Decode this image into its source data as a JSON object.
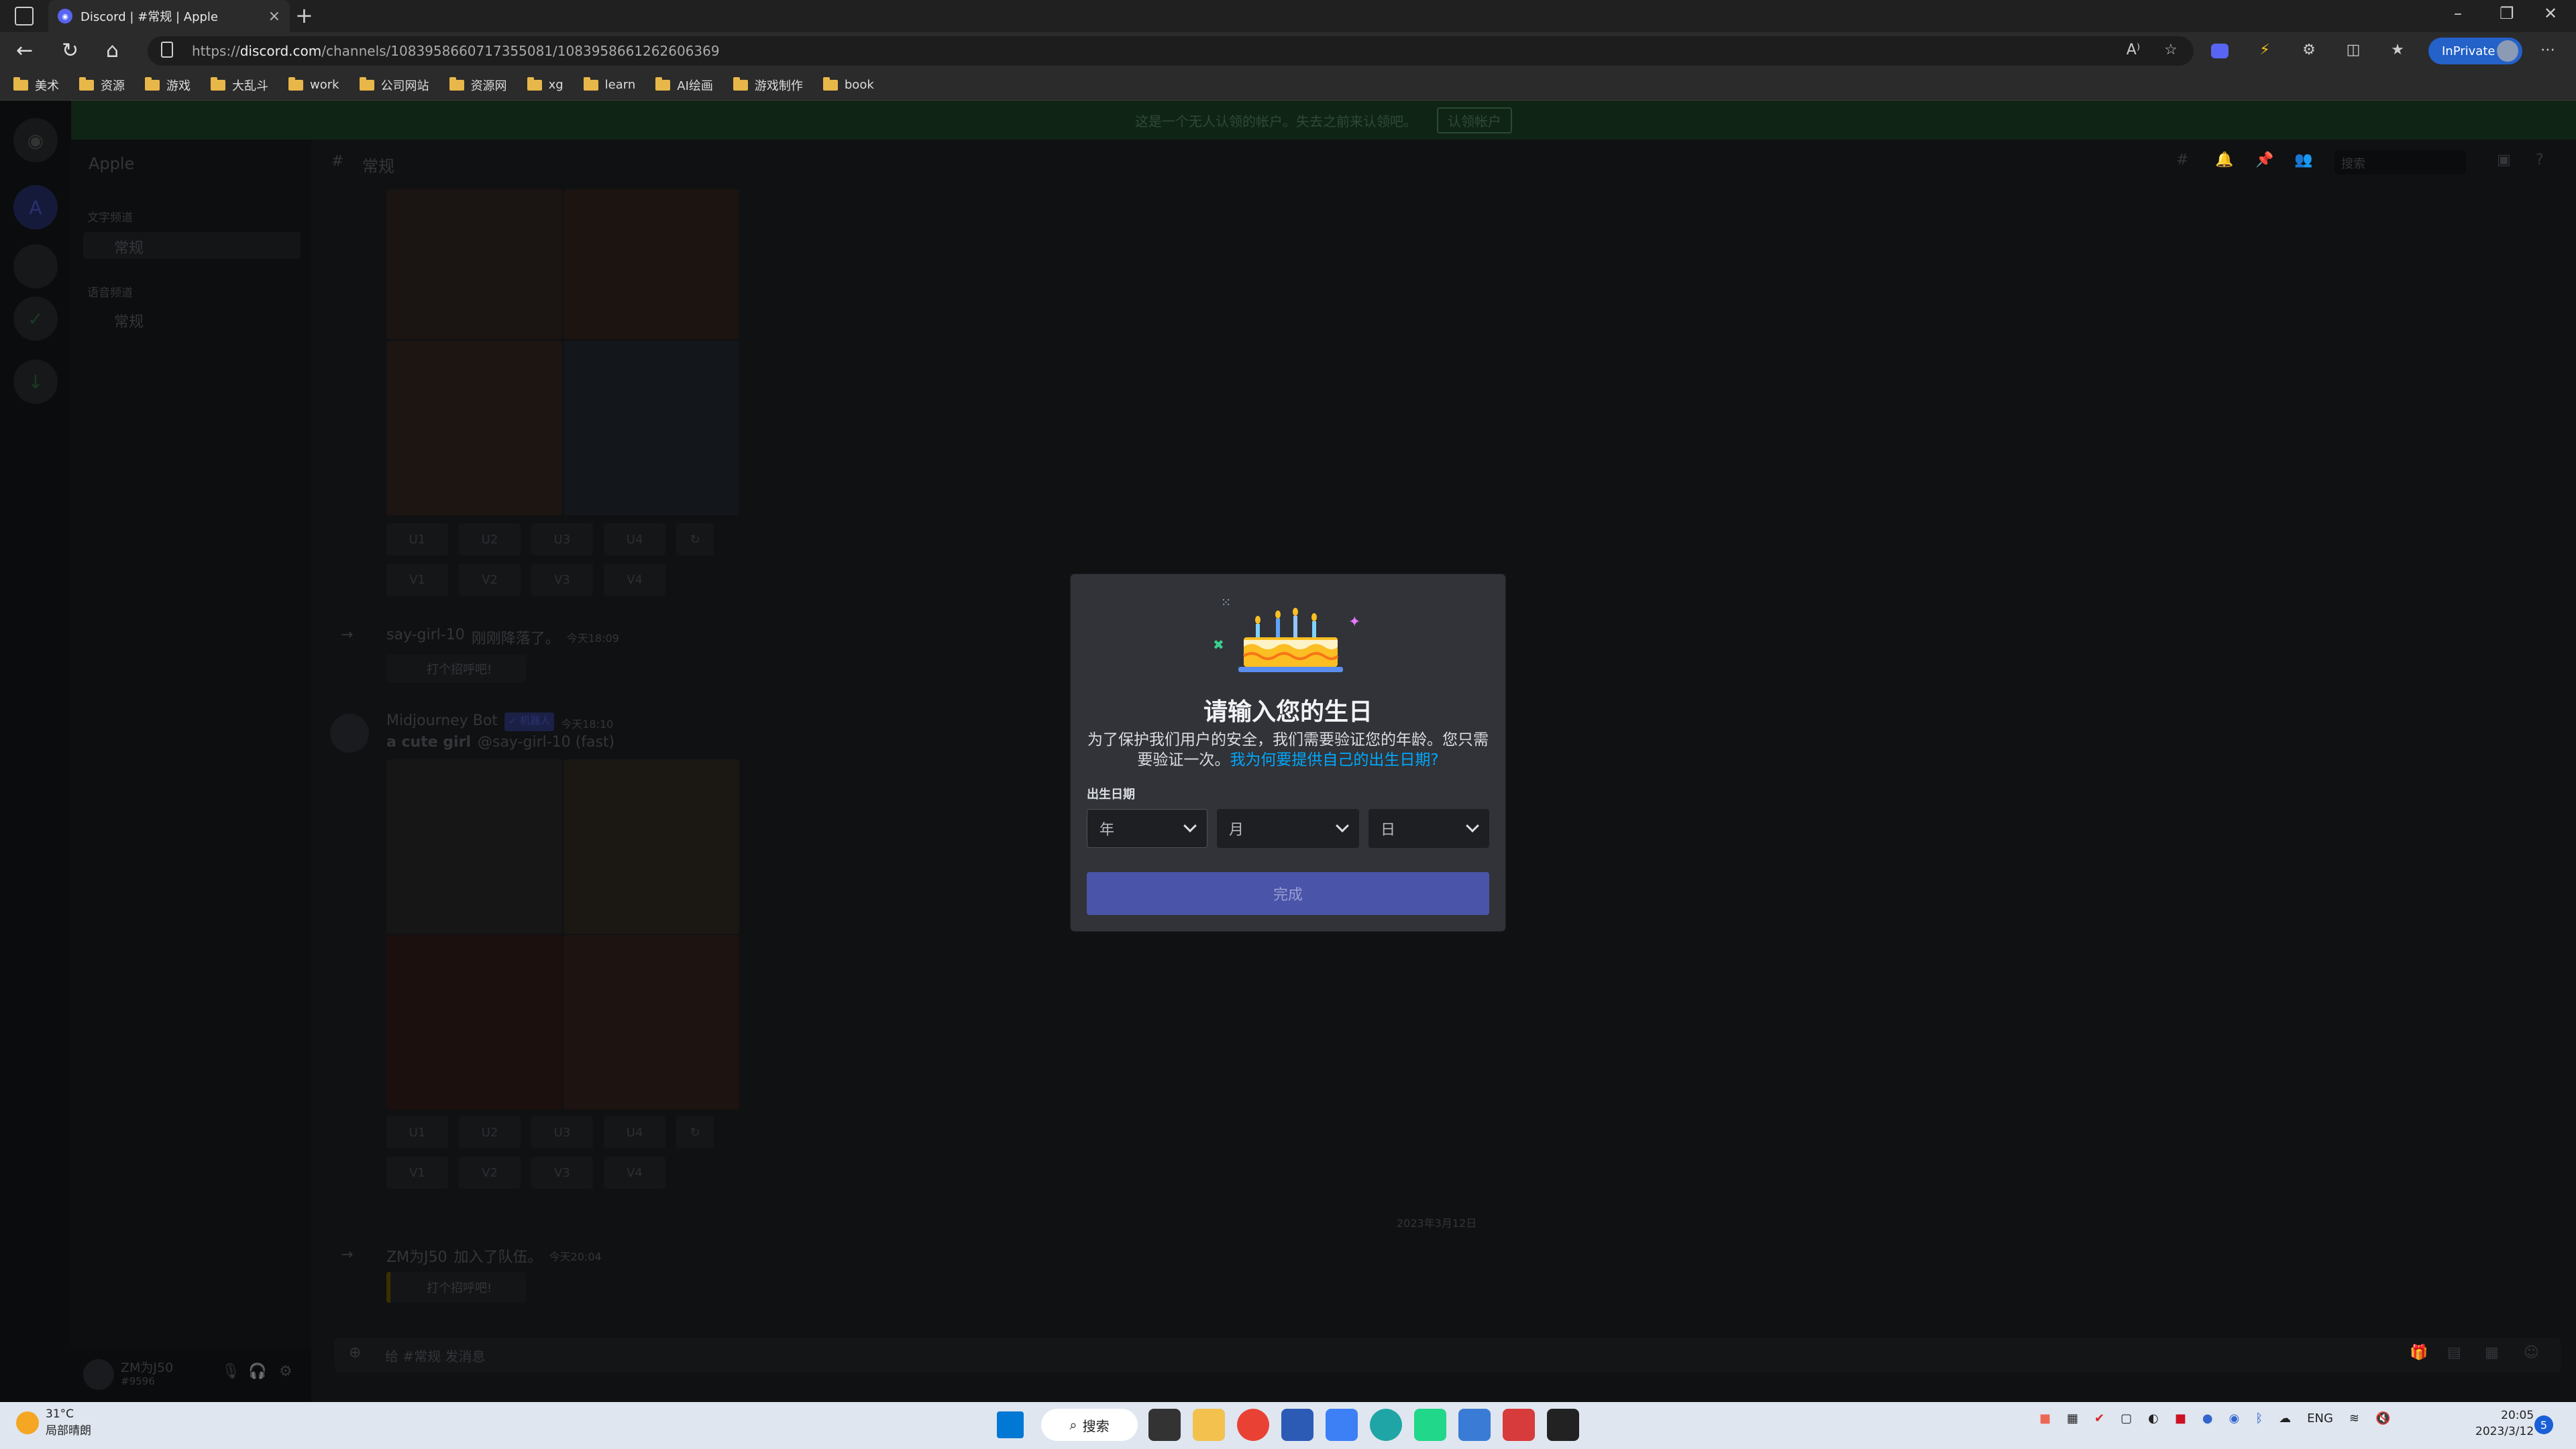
{
  "browser": {
    "tab_title": "Discord | #常规 | Apple",
    "new_tab": "+",
    "url_prefix": "https://",
    "url_host": "discord.com",
    "url_path": "/channels/1083958660717355081/1083958661262606369",
    "inprivate_label": "InPrivate",
    "bookmarks": [
      "美术",
      "资源",
      "游戏",
      "大乱斗",
      "work",
      "公司网站",
      "资源网",
      "xg",
      "learn",
      "AI绘画",
      "游戏制作",
      "book"
    ]
  },
  "discord": {
    "notice": "这是一个无人认领的帐户。失去之前来认领吧。",
    "notice_button": "认领帐户",
    "server_name": "Apple",
    "text_channels_header": "文字频道",
    "voice_channels_header": "语音频道",
    "channel_general": "常规",
    "voice_general": "常规",
    "chat_header": "常规",
    "search_placeholder": "搜索",
    "upscale_buttons": [
      "U1",
      "U2",
      "U3",
      "U4"
    ],
    "variation_buttons": [
      "V1",
      "V2",
      "V3",
      "V4"
    ],
    "join_msg_1_user": "say-girl-10",
    "join_msg_1_text": "刚刚降落了。",
    "join_msg_1_time": "今天18:09",
    "wave_button_1": "打个招呼吧!",
    "bot_name": "Midjourney Bot",
    "bot_tag": "✓ 机器人",
    "bot_time": "今天18:10",
    "bot_prompt": "a cute girl",
    "bot_mention": "@say-girl-10 (fast)",
    "date_divider": "2023年3月12日",
    "join_msg_2_user": "ZM为J50",
    "join_msg_2_text": "加入了队伍。",
    "join_msg_2_time": "今天20:04",
    "wave_button_2": "打个招呼吧!",
    "composer_placeholder": "给 #常规 发消息",
    "user_name": "ZM为J50",
    "user_tag": "#9596"
  },
  "modal": {
    "title": "请输入您的生日",
    "desc": "为了保护我们用户的安全，我们需要验证您的年龄。您只需要验证一次。",
    "desc_link": "我为何要提供自己的出生日期?",
    "dob_label": "出生日期",
    "year_placeholder": "年",
    "month_placeholder": "月",
    "day_placeholder": "日",
    "done_label": "完成"
  },
  "taskbar": {
    "temperature": "31°C",
    "weather_desc": "局部晴朗",
    "search_label": "搜索",
    "lang": "ENG",
    "time": "20:05",
    "date": "2023/3/12",
    "notifications": "5"
  },
  "colors": {
    "modal_bg": "#313338",
    "button_primary": "#4a54a8",
    "link": "#00a8fc",
    "taskbar": "#dfe6f0"
  }
}
